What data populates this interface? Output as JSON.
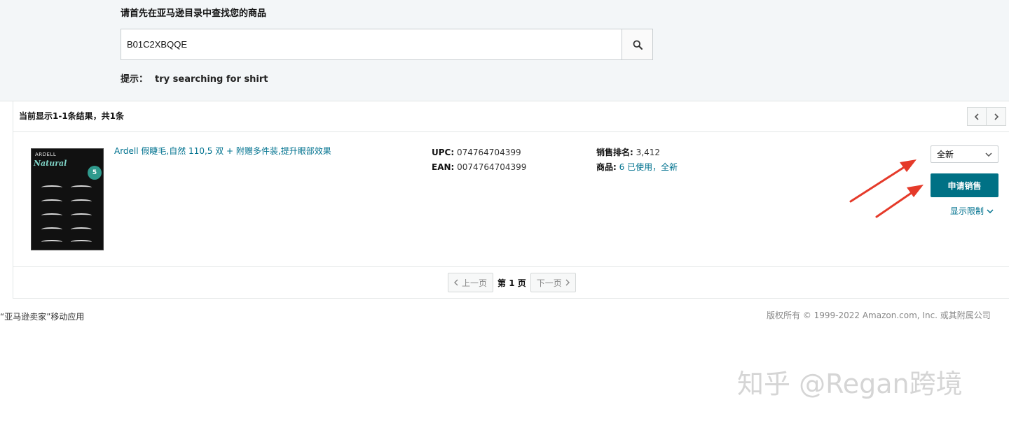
{
  "search": {
    "heading": "请首先在亚马逊目录中查找您的商品",
    "value": "B01C2XBQQE",
    "hint_label": "提示：",
    "hint_text": "try searching for shirt"
  },
  "results": {
    "summary": "当前显示1-1条结果，共1条"
  },
  "product": {
    "title": "Ardell 假睫毛,自然 110,5 双 + 附赠多件装,提升眼部效果",
    "image": {
      "brand": "ARDELL",
      "line": "Natural",
      "badge": "5"
    },
    "upc_label": "UPC:",
    "upc": "074764704399",
    "ean_label": "EAN:",
    "ean": "0074764704399",
    "rank_label": "销售排名:",
    "rank": "3,412",
    "offers_label": "商品:",
    "offers": "6 已使用，全新",
    "condition": "全新",
    "apply_button": "申请销售",
    "show_limits": "显示限制"
  },
  "pagination": {
    "prev": "上一页",
    "current": "第 1 页",
    "next": "下一页"
  },
  "footer": {
    "left": "“亚马逊卖家”移动应用",
    "right": "版权所有 © 1999-2022 Amazon.com, Inc. 或其附属公司"
  },
  "watermark": "知乎 @Regan跨境",
  "colors": {
    "accent": "#007185",
    "link": "#00728f",
    "annotation_arrow": "#e53a2a"
  },
  "icons": {
    "search": "search-icon",
    "prev": "chevron-left-icon",
    "next": "chevron-right-icon",
    "dropdown": "chevron-down-icon"
  }
}
